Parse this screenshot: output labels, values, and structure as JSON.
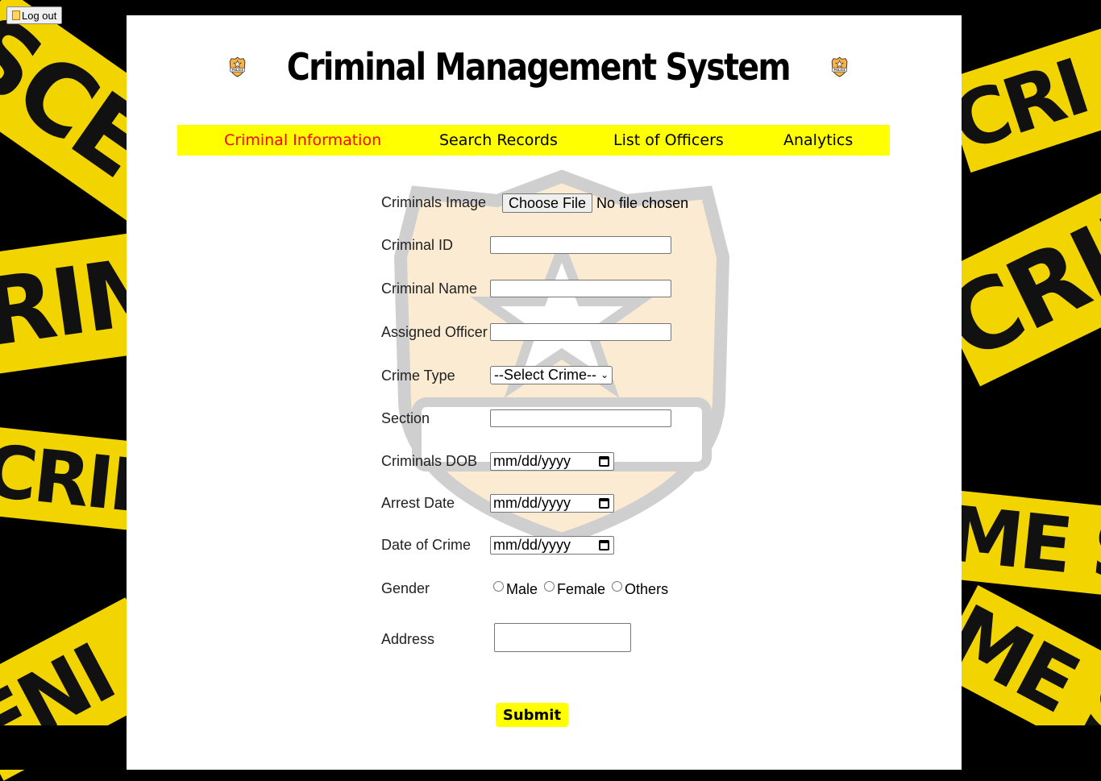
{
  "logout": {
    "label": "Log out"
  },
  "header": {
    "title": "Criminal Management System",
    "badge_text": "POLICE"
  },
  "nav": {
    "items": [
      {
        "label": "Criminal Information",
        "active": true
      },
      {
        "label": "Search Records",
        "active": false
      },
      {
        "label": "List of Officers",
        "active": false
      },
      {
        "label": "Analytics",
        "active": false
      }
    ]
  },
  "background": {
    "tape_texts": [
      "SCE",
      "RIM",
      "CRIME",
      "ENI",
      "CRI",
      "CRIM",
      "ME SC",
      "ME S"
    ]
  },
  "form": {
    "labels": {
      "image": "Criminals Image",
      "id": "Criminal ID",
      "name": "Criminal Name",
      "officer": "Assigned Officer",
      "crime_type": "Crime Type",
      "section": "Section",
      "dob": "Criminals DOB",
      "arrest_date": "Arrest Date",
      "crime_date": "Date of Crime",
      "gender": "Gender",
      "address": "Address"
    },
    "file_button": "Choose File",
    "file_status": "No file chosen",
    "crime_select": "--Select Crime--",
    "date_placeholder": "mm/dd/yyyy",
    "gender_options": [
      "Male",
      "Female",
      "Others"
    ],
    "submit": "Submit"
  },
  "colors": {
    "accent": "#ffff00",
    "active_nav": "#ff0000",
    "tape": "#f2d400"
  }
}
